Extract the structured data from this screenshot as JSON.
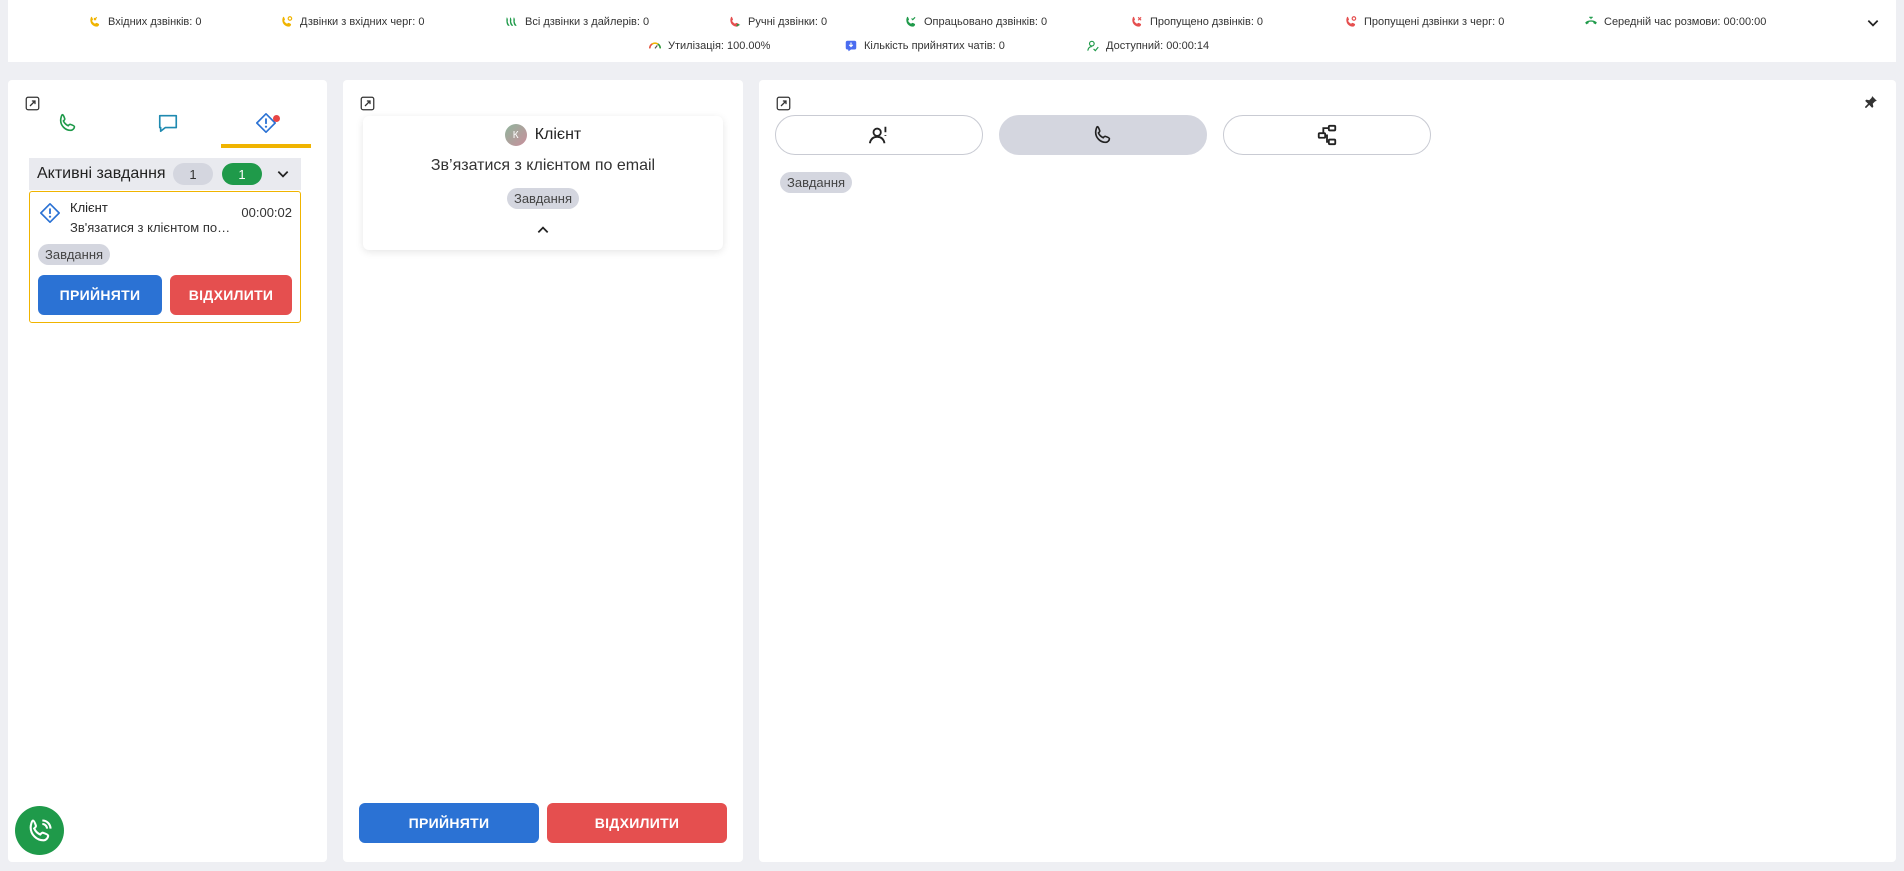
{
  "stats": {
    "row1": [
      {
        "icon": "incoming-call-icon",
        "label": "Вхідних дзвінків: 0",
        "color": "#f0b400"
      },
      {
        "icon": "queue-calls-icon",
        "label": "Дзвінки з вхідних черг: 0",
        "color": "#f0b400"
      },
      {
        "icon": "dialer-calls-icon",
        "label": "Всі дзвінки з дайлерів: 0",
        "color": "#1f9a4a"
      },
      {
        "icon": "manual-call-icon",
        "label": "Ручні дзвінки: 0",
        "color": "#e54f4f"
      },
      {
        "icon": "processed-call-icon",
        "label": "Опрацьовано дзвінків: 0",
        "color": "#1f9a4a"
      },
      {
        "icon": "missed-call-icon",
        "label": "Пропущено дзвінків: 0",
        "color": "#e54f4f"
      },
      {
        "icon": "missed-queue-call-icon",
        "label": "Пропущені дзвінки з черг: 0",
        "color": "#e54f4f"
      },
      {
        "icon": "avg-talk-time-icon",
        "label": "Середній час розмови: 00:00:00",
        "color": "#1f9a4a"
      }
    ],
    "row2": [
      {
        "icon": "utilization-gauge-icon",
        "label": "Утилізація: 100.00%"
      },
      {
        "icon": "accepted-chats-icon",
        "label": "Кількість прийнятих чатів: 0",
        "color": "#4a6cf0"
      },
      {
        "icon": "available-status-icon",
        "label": "Доступний: 00:00:14",
        "color": "#1f9a4a"
      }
    ]
  },
  "left_panel": {
    "tabs": [
      {
        "name": "calls",
        "icon": "phone-icon"
      },
      {
        "name": "chats",
        "icon": "chat-icon"
      },
      {
        "name": "tasks",
        "icon": "task-icon",
        "active": true,
        "has_notification": true
      }
    ],
    "tasks_header": {
      "title": "Активні завдання",
      "count_total": "1",
      "count_active": "1"
    },
    "task": {
      "client": "Клієнт",
      "description": "Зв'язатися з клієнтом по email",
      "timer": "00:00:02",
      "tag": "Завдання",
      "accept_label": "ПРИЙНЯТИ",
      "reject_label": "ВІДХИЛИТИ"
    }
  },
  "middle_panel": {
    "avatar_letter": "К",
    "client": "Клієнт",
    "subject": "Зв’язатися з клієнтом по email",
    "tag": "Завдання",
    "accept_label": "ПРИЙНЯТИ",
    "reject_label": "ВІДХИЛИТИ"
  },
  "right_panel": {
    "modes": [
      {
        "icon": "operator-info-icon"
      },
      {
        "icon": "phone-icon",
        "active": true
      },
      {
        "icon": "workflow-icon"
      }
    ],
    "tag": "Завдання"
  },
  "colors": {
    "accent_yellow": "#f0b400",
    "accept_blue": "#2b72d4",
    "reject_red": "#e54f4f",
    "green": "#1f9a4a"
  }
}
